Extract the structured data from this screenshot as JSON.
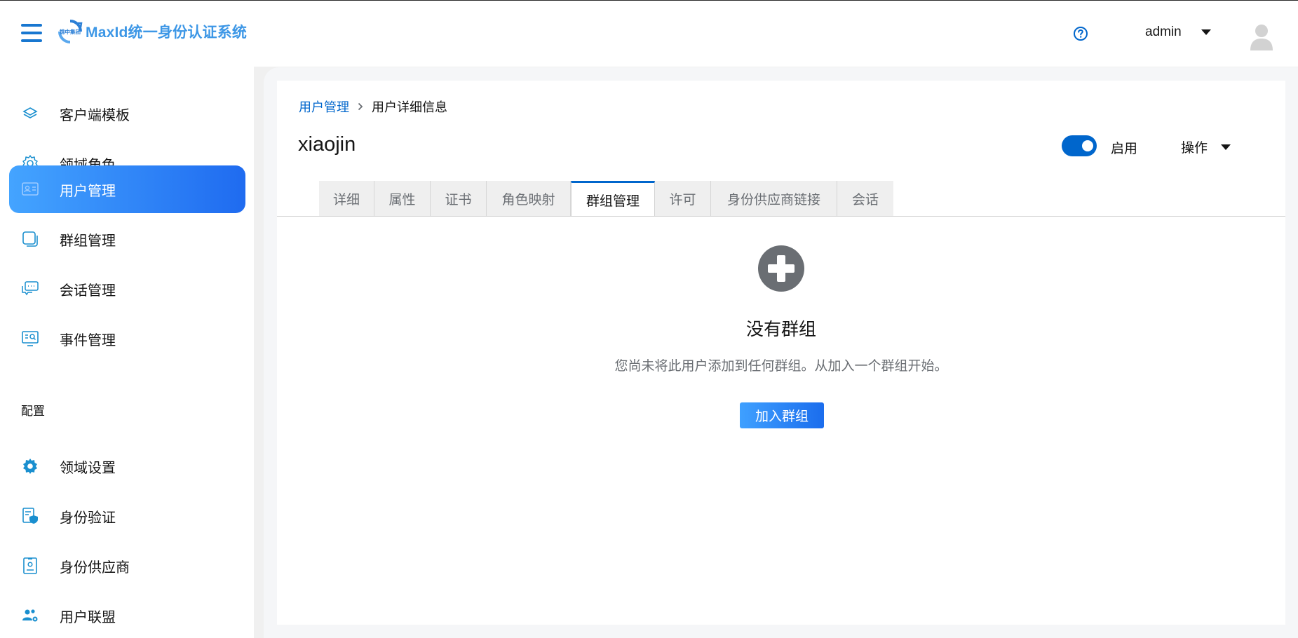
{
  "header": {
    "app_title": "MaxId统一身份认证系统",
    "logo_caption": "锦中集团",
    "user_name": "admin"
  },
  "sidebar": {
    "items": [
      {
        "label": "客户端模板",
        "icon": "layers-icon"
      },
      {
        "label": "领域角色",
        "icon": "gear-outline-icon"
      },
      {
        "label": "用户管理",
        "icon": "id-card-icon",
        "active": true
      },
      {
        "label": "群组管理",
        "icon": "group-squares-icon"
      },
      {
        "label": "会话管理",
        "icon": "chat-bubbles-icon"
      },
      {
        "label": "事件管理",
        "icon": "event-monitor-icon"
      }
    ],
    "section_label": "配置",
    "config_items": [
      {
        "label": "领域设置",
        "icon": "gear-filled-icon"
      },
      {
        "label": "身份验证",
        "icon": "shield-doc-icon"
      },
      {
        "label": "身份供应商",
        "icon": "id-badge-icon"
      },
      {
        "label": "用户联盟",
        "icon": "users-federation-icon"
      }
    ]
  },
  "breadcrumb": {
    "parent": "用户管理",
    "current": "用户详细信息"
  },
  "page": {
    "title": "xiaojin",
    "enabled_label": "启用",
    "enabled": true,
    "actions_label": "操作"
  },
  "tabs": [
    {
      "label": "详细"
    },
    {
      "label": "属性"
    },
    {
      "label": "证书"
    },
    {
      "label": "角色映射"
    },
    {
      "label": "群组管理",
      "active": true
    },
    {
      "label": "许可"
    },
    {
      "label": "身份供应商链接"
    },
    {
      "label": "会话"
    }
  ],
  "empty_state": {
    "title": "没有群组",
    "description": "您尚未将此用户添加到任何群组。从加入一个群组开始。",
    "button_label": "加入群组"
  },
  "colors": {
    "brand_blue": "#0066cc",
    "logo_blue": "#3d97e6",
    "active_gradient_start": "#44a4ff",
    "active_gradient_end": "#1f6bf0"
  }
}
